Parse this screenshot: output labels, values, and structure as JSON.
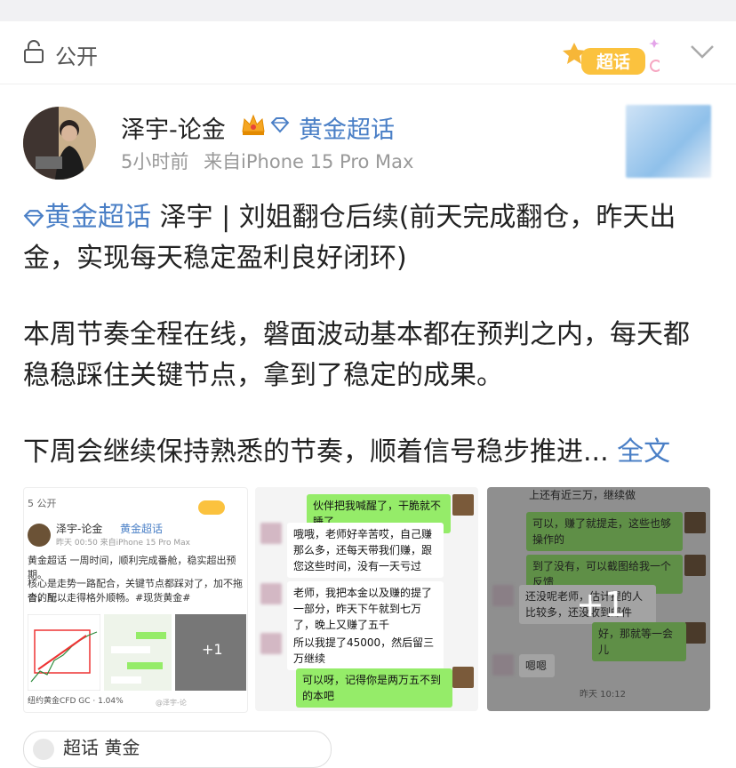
{
  "header": {
    "visibility_label": "公开",
    "icons": [
      "lock-icon",
      "super-topic-badge-icon",
      "chevron-down-icon"
    ]
  },
  "post": {
    "author": "泽宇-论金",
    "author_topic": "黄金超话",
    "time": "5小时前",
    "source": "来自iPhone 15 Pro Max",
    "topic_tag": "黄金超话",
    "line1": "泽宇 | 刘姐翻仓后续(前天完成翻仓，昨天出",
    "line2": "金，实现每天稳定盈利良好闭环)",
    "para2_line1": "本周节奏全程在线，磐面波动基本都在预判之内，每天都",
    "para2_line2": "稳稳踩住关键节点，拿到了稳定的成果。",
    "para3": "下周会继续保持熟悉的节奏，顺着信号稳步推进...",
    "full_text_link": "全文"
  },
  "thumb1": {
    "visibility": "5 公开",
    "author": "泽宇-论金",
    "topic": "黄金超话",
    "meta": "昨天 00:50  来自iPhone 15 Pro Max",
    "text1": "黄金超话 一周时间，顺利完成番舱，稳实超出预期。",
    "text2": "核心是走势一路配合，关键节点都踩对了，加不拖沓的配",
    "text3": "合，所以走得格外顺畅。#现货黄金#",
    "quote": "纽约黄金CFD GC · 1.04%",
    "plus": "+1",
    "watermark": "@泽宇-论"
  },
  "thumb2": {
    "msgs": [
      "伙伴把我喊醒了，干脆就不睡了",
      "哦哦，老师好辛苦哎，自己赚那么多，还每天带我们赚，跟您这些时间，没有一天亏过",
      "老师，我把本金以及赚的提了一部分，昨天下午就到七万了，晚上又赚了五千",
      "所以我提了45000，然后留三万继续",
      "可以呀，记得你是两万五不到的本吧"
    ]
  },
  "thumb3": {
    "msgs": [
      "上还有近三万，继续做",
      "可以，赚了就提走，这些也够操作的",
      "到了没有，可以截图给我一个反馈",
      "还没呢老师，估计提的人比较多，还没收到邮件",
      "好，那就等一会儿",
      "嗯嗯"
    ],
    "time": "昨天 10:12",
    "plus": "+1"
  },
  "bottom": {
    "partial_label": "超话 黄金"
  },
  "colors": {
    "accent": "#4a7fc6",
    "wechat_green": "#95ec69"
  }
}
